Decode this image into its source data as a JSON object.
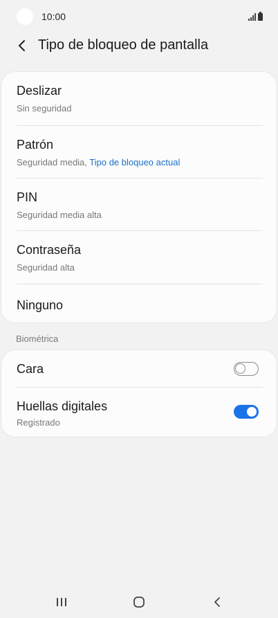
{
  "status_bar": {
    "time": "10:00"
  },
  "header": {
    "title": "Tipo de bloqueo de pantalla",
    "back_icon": "chevron-left-icon"
  },
  "lock_types": [
    {
      "title": "Deslizar",
      "subtitle": "Sin seguridad",
      "subtitle_accent": ""
    },
    {
      "title": "Patrón",
      "subtitle": "Seguridad media, ",
      "subtitle_accent": "Tipo de bloqueo actual"
    },
    {
      "title": "PIN",
      "subtitle": "Seguridad media alta",
      "subtitle_accent": ""
    },
    {
      "title": "Contraseña",
      "subtitle": "Seguridad alta",
      "subtitle_accent": ""
    },
    {
      "title": "Ninguno",
      "subtitle": "",
      "subtitle_accent": ""
    }
  ],
  "biometrics": {
    "section_label": "Biométrica",
    "items": [
      {
        "title": "Cara",
        "subtitle": "",
        "enabled": false
      },
      {
        "title": "Huellas digitales",
        "subtitle": "Registrado",
        "enabled": true
      }
    ]
  },
  "colors": {
    "accent": "#1a73e8",
    "link": "#1c6fc9",
    "background": "#f2f2f2"
  },
  "nav_bar": {
    "recents_icon": "recents-icon",
    "home_icon": "home-icon",
    "back_icon": "back-icon"
  }
}
